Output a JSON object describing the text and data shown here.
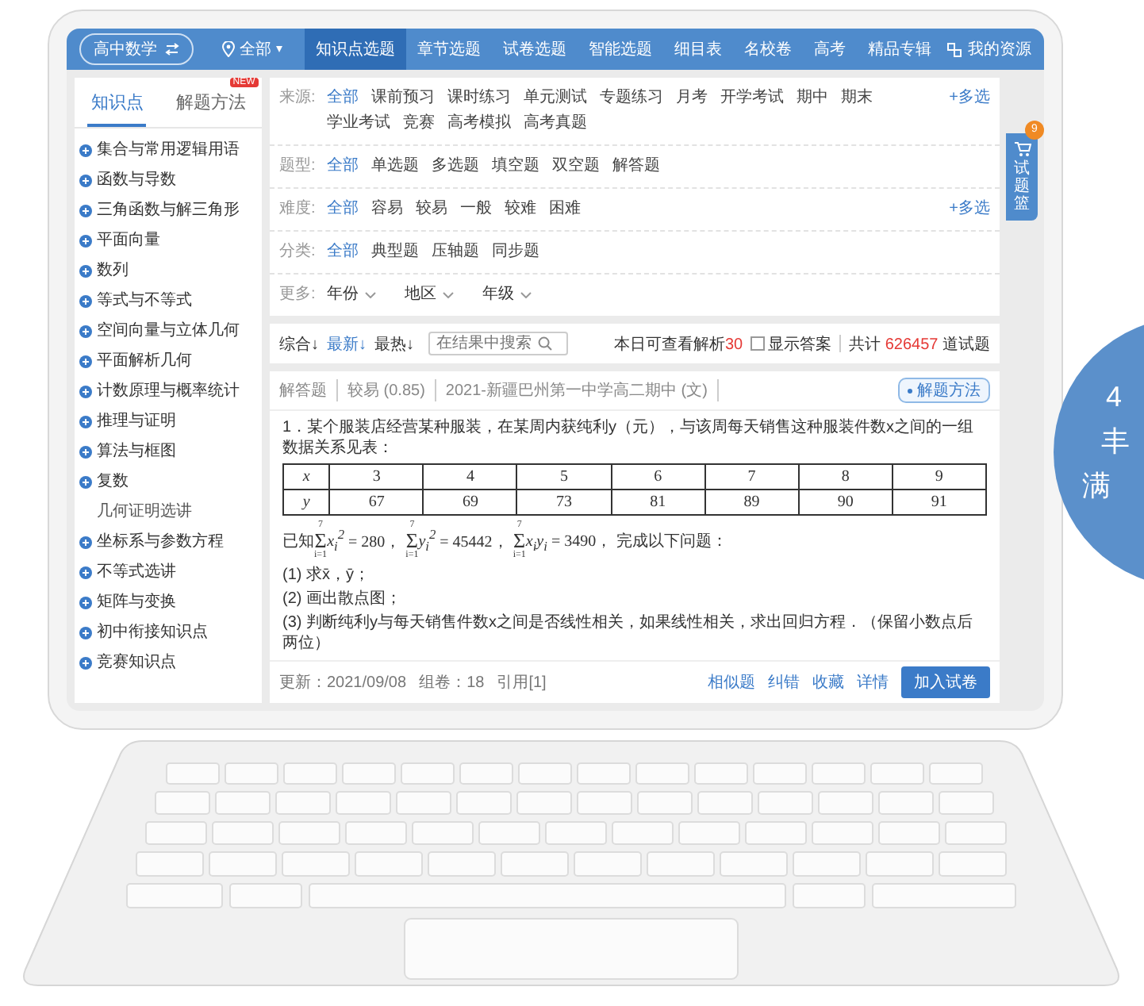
{
  "nav": {
    "subject": "高中数学",
    "region": "全部",
    "items": [
      {
        "label": "知识点选题",
        "selected": true
      },
      {
        "label": "章节选题",
        "selected": false
      },
      {
        "label": "试卷选题",
        "selected": false
      },
      {
        "label": "智能选题",
        "selected": false
      },
      {
        "label": "细目表",
        "selected": false
      },
      {
        "label": "名校卷",
        "selected": false
      },
      {
        "label": "高考",
        "selected": false
      },
      {
        "label": "精品专辑",
        "selected": false
      }
    ],
    "my_resources": "我的资源"
  },
  "sidebar": {
    "tabs": [
      {
        "label": "知识点",
        "selected": true
      },
      {
        "label": "解题方法",
        "selected": false,
        "badge": "NEW"
      }
    ],
    "items": [
      {
        "label": "集合与常用逻辑用语",
        "kind": "topic"
      },
      {
        "label": "函数与导数",
        "kind": "topic"
      },
      {
        "label": "三角函数与解三角形",
        "kind": "topic"
      },
      {
        "label": "平面向量",
        "kind": "topic"
      },
      {
        "label": "数列",
        "kind": "topic"
      },
      {
        "label": "等式与不等式",
        "kind": "topic"
      },
      {
        "label": "空间向量与立体几何",
        "kind": "topic"
      },
      {
        "label": "平面解析几何",
        "kind": "topic"
      },
      {
        "label": "计数原理与概率统计",
        "kind": "topic"
      },
      {
        "label": "推理与证明",
        "kind": "topic"
      },
      {
        "label": "算法与框图",
        "kind": "topic"
      },
      {
        "label": "复数",
        "kind": "topic"
      },
      {
        "label": "几何证明选讲",
        "kind": "leaf"
      },
      {
        "label": "坐标系与参数方程",
        "kind": "topic"
      },
      {
        "label": "不等式选讲",
        "kind": "topic"
      },
      {
        "label": "矩阵与变换",
        "kind": "topic"
      },
      {
        "label": "初中衔接知识点",
        "kind": "topic"
      },
      {
        "label": "竞赛知识点",
        "kind": "topic"
      }
    ]
  },
  "filters": [
    {
      "label": "来源:",
      "kind": "chips",
      "multi": "+多选",
      "options": [
        {
          "label": "全部",
          "selected": true
        },
        {
          "label": "课前预习",
          "selected": false
        },
        {
          "label": "课时练习",
          "selected": false
        },
        {
          "label": "单元测试",
          "selected": false
        },
        {
          "label": "专题练习",
          "selected": false
        },
        {
          "label": "月考",
          "selected": false
        },
        {
          "label": "开学考试",
          "selected": false
        },
        {
          "label": "期中",
          "selected": false
        },
        {
          "label": "期末",
          "selected": false
        },
        {
          "label": "学业考试",
          "selected": false
        },
        {
          "label": "竞赛",
          "selected": false
        },
        {
          "label": "高考模拟",
          "selected": false
        },
        {
          "label": "高考真题",
          "selected": false
        }
      ]
    },
    {
      "label": "题型:",
      "kind": "chips",
      "options": [
        {
          "label": "全部",
          "selected": true
        },
        {
          "label": "单选题",
          "selected": false
        },
        {
          "label": "多选题",
          "selected": false
        },
        {
          "label": "填空题",
          "selected": false
        },
        {
          "label": "双空题",
          "selected": false
        },
        {
          "label": "解答题",
          "selected": false
        }
      ]
    },
    {
      "label": "难度:",
      "kind": "chips",
      "multi": "+多选",
      "options": [
        {
          "label": "全部",
          "selected": true
        },
        {
          "label": "容易",
          "selected": false
        },
        {
          "label": "较易",
          "selected": false
        },
        {
          "label": "一般",
          "selected": false
        },
        {
          "label": "较难",
          "selected": false
        },
        {
          "label": "困难",
          "selected": false
        }
      ]
    },
    {
      "label": "分类:",
      "kind": "chips",
      "options": [
        {
          "label": "全部",
          "selected": true
        },
        {
          "label": "典型题",
          "selected": false
        },
        {
          "label": "压轴题",
          "selected": false
        },
        {
          "label": "同步题",
          "selected": false
        }
      ]
    },
    {
      "label": "更多:",
      "kind": "dropdowns",
      "options": [
        {
          "label": "年份"
        },
        {
          "label": "地区"
        },
        {
          "label": "年级"
        }
      ]
    }
  ],
  "toolbar": {
    "sorts": [
      {
        "label": "综合↓",
        "selected": false
      },
      {
        "label": "最新↓",
        "selected": true
      },
      {
        "label": "最热↓",
        "selected": false
      }
    ],
    "search": {
      "placeholder": "在结果中搜索"
    },
    "quota_label": "本日可查看解析",
    "quota": "30",
    "show_answer": {
      "label": "显示答案",
      "checked": false
    },
    "total_prefix": "共计",
    "total": "626457",
    "total_suffix": "道试题"
  },
  "question": {
    "meta": [
      "解答题",
      "较易 (0.85)",
      "2021-新疆巴州第一中学高二期中 (文)"
    ],
    "method_button": "解题方法",
    "stem": "1．某个服装店经营某种服装，在某周内获纯利y（元），与该周每天销售这种服装件数x之间的一组数据关系见表：",
    "table": [
      [
        "x",
        "3",
        "4",
        "5",
        "6",
        "7",
        "8",
        "9"
      ],
      [
        "y",
        "67",
        "69",
        "73",
        "81",
        "89",
        "90",
        "91"
      ]
    ],
    "given": {
      "prefix": "已知",
      "sums": [
        {
          "symbol": "Σ",
          "upper": "7",
          "lower": "i=1",
          "term": "x$_{i}$$^{2}$",
          "value": "= 280，"
        },
        {
          "symbol": "Σ",
          "upper": "7",
          "lower": "i=1",
          "term": "y$_{i}$$^{2}$",
          "value": "= 45442，"
        },
        {
          "symbol": "Σ",
          "upper": "7",
          "lower": "i=1",
          "term": "x$_{i}$y$_{i}$",
          "value": "= 3490，"
        }
      ],
      "suffix": "完成以下问题："
    },
    "parts": [
      "(1) 求x̄，ȳ；",
      "(2) 画出散点图；",
      "(3) 判断纯利y与每天销售件数x之间是否线性相关，如果线性相关，求出回归方程．（保留小数点后两位）"
    ],
    "info": [
      "更新：2021/09/08",
      "组卷：18",
      "引用[1]"
    ],
    "links": [
      "相似题",
      "纠错",
      "收藏",
      "详情"
    ],
    "add_button": "加入试卷"
  },
  "cart": {
    "label": "试题篮",
    "count": "9"
  },
  "promo": {
    "lines": [
      "4",
      "丰",
      "满"
    ]
  }
}
